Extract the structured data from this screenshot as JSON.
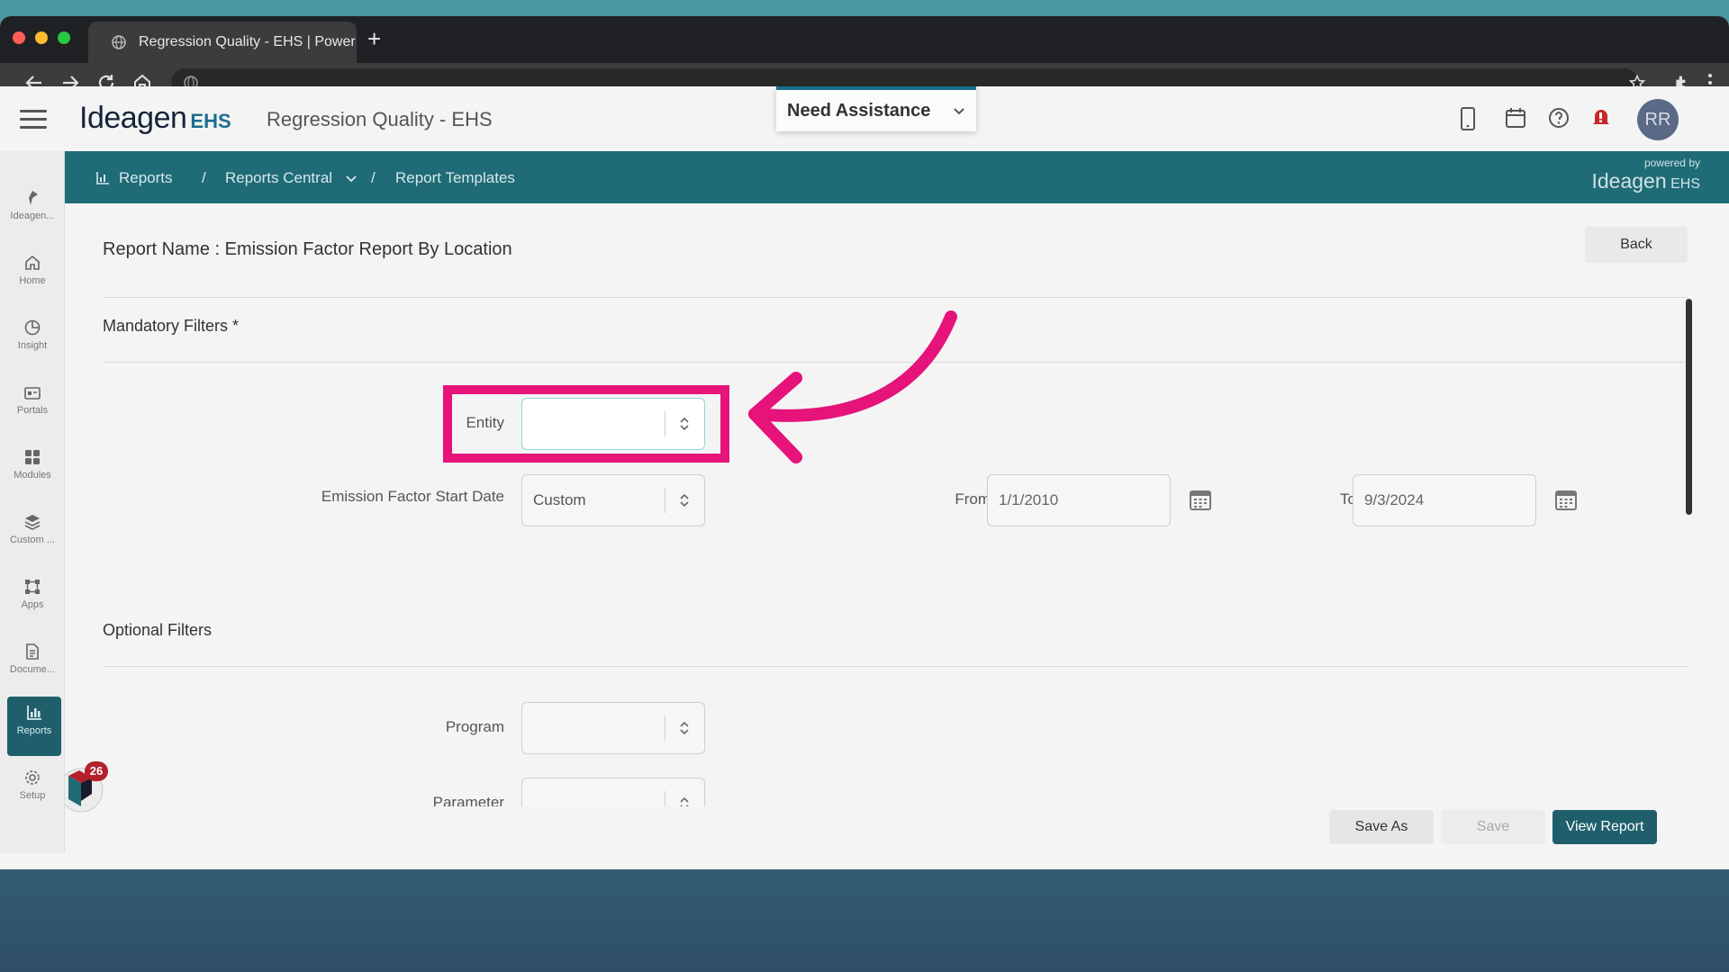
{
  "browser": {
    "tab_title": "Regression Quality - EHS | Power",
    "new_tab_label": "+"
  },
  "header": {
    "logo_text": "Ideagen",
    "logo_suffix": "EHS",
    "app_title": "Regression Quality - EHS",
    "assist_label": "Need Assistance",
    "avatar_initials": "RR",
    "icons": [
      "mobile-icon",
      "calendar-icon",
      "help-icon",
      "notification-bell-icon"
    ]
  },
  "sidebar": {
    "items": [
      {
        "label": "Ideagen...",
        "icon": "ideagen-icon"
      },
      {
        "label": "Home",
        "icon": "home-icon"
      },
      {
        "label": "Insight",
        "icon": "insight-icon"
      },
      {
        "label": "Portals",
        "icon": "portals-icon"
      },
      {
        "label": "Modules",
        "icon": "modules-icon"
      },
      {
        "label": "Custom ...",
        "icon": "custom-icon"
      },
      {
        "label": "Apps",
        "icon": "apps-icon"
      },
      {
        "label": "Docume...",
        "icon": "documents-icon"
      },
      {
        "label": "Reports",
        "icon": "reports-icon",
        "active": true
      },
      {
        "label": "Setup",
        "icon": "setup-icon"
      }
    ]
  },
  "breadcrumb": {
    "reports": "Reports",
    "sep1": "/",
    "reports_central": "Reports Central",
    "sep2": "/",
    "report_templates": "Report Templates",
    "powered_by": "powered by",
    "powered_logo": "Ideagen",
    "powered_suffix": "EHS"
  },
  "main": {
    "report_name": "Report Name : Emission Factor Report By Location",
    "back_label": "Back",
    "mandatory_title": "Mandatory Filters *",
    "optional_title": "Optional Filters",
    "entity_label": "Entity",
    "entity_value": "",
    "start_date_label": "Emission Factor Start Date",
    "start_date_value": "Custom",
    "from_label": "From",
    "from_value": "1/1/2010",
    "to_label": "To",
    "to_value": "9/3/2024",
    "program_label": "Program",
    "program_value": "",
    "parameter_label": "Parameter"
  },
  "footer": {
    "save_as_label": "Save As",
    "save_label": "Save",
    "view_report_label": "View Report"
  },
  "widget": {
    "badge_count": "26"
  },
  "colors": {
    "teal": "#1f6b76",
    "annotation": "#e5137a",
    "view_report": "#1e5f6b"
  }
}
